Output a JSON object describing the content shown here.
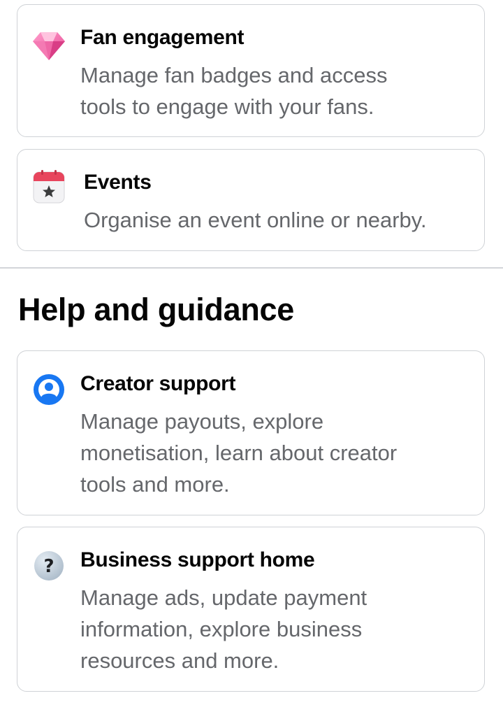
{
  "cards_top": [
    {
      "title": "Fan engagement",
      "description": "Manage fan badges and access tools to engage with your fans.",
      "icon": "diamond-icon"
    },
    {
      "title": "Events",
      "description": "Organise an event online or nearby.",
      "icon": "calendar-star-icon"
    }
  ],
  "help_section": {
    "title": "Help and guidance",
    "cards": [
      {
        "title": "Creator support",
        "description": "Manage payouts, explore monetisation, learn about creator tools and more.",
        "icon": "creator-support-icon"
      },
      {
        "title": "Business support home",
        "description": "Manage ads, update payment information, explore business resources and more.",
        "icon": "question-icon"
      }
    ]
  },
  "colors": {
    "diamond": "#f06aa8",
    "calendar_header": "#e8455d",
    "creator_support": "#1877f2",
    "question_bg": "#b8c6d3"
  }
}
